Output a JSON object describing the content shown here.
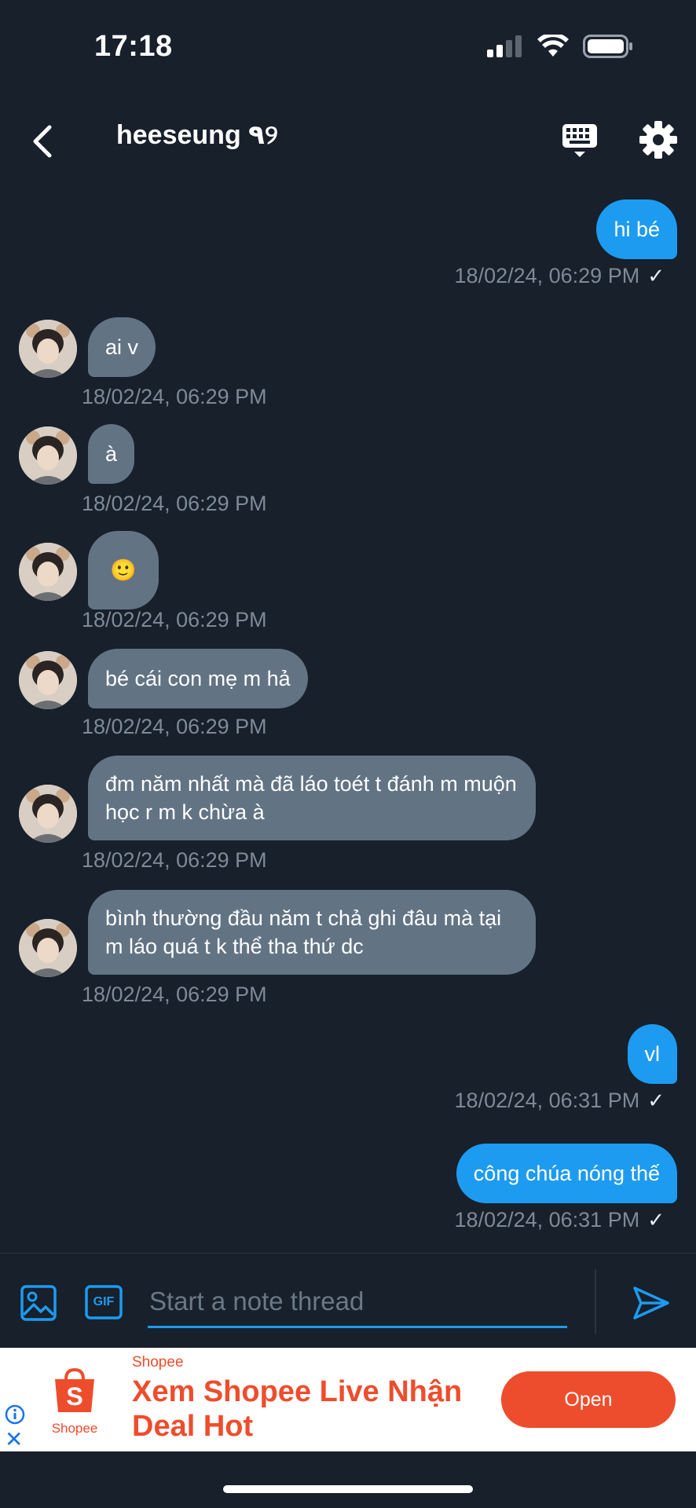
{
  "status_bar": {
    "time": "17:18"
  },
  "header": {
    "title": "heeseung ٩୨"
  },
  "messages": [
    {
      "direction": "out",
      "text": "hi bé",
      "timestamp": "18/02/24, 06:29 PM",
      "read": true
    },
    {
      "direction": "in",
      "text": "ai v",
      "timestamp": "18/02/24, 06:29 PM"
    },
    {
      "direction": "in",
      "text": "à",
      "timestamp": "18/02/24, 06:29 PM"
    },
    {
      "direction": "in",
      "text": "🙂",
      "timestamp": "18/02/24, 06:29 PM"
    },
    {
      "direction": "in",
      "text": "bé cái con mẹ m hả",
      "timestamp": "18/02/24, 06:29 PM"
    },
    {
      "direction": "in",
      "text": "đm năm nhất mà đã láo toét t đánh m muộn học r m k chừa à",
      "timestamp": "18/02/24, 06:29 PM"
    },
    {
      "direction": "in",
      "text": "bình thường đầu năm t chả ghi đâu mà tại m láo quá t k thể tha thứ dc",
      "timestamp": "18/02/24, 06:29 PM"
    },
    {
      "direction": "out",
      "text": "vl",
      "timestamp": "18/02/24, 06:31 PM",
      "read": true
    },
    {
      "direction": "out",
      "text": "công chúa nóng thế",
      "timestamp": "18/02/24, 06:31 PM",
      "read": true
    }
  ],
  "compose": {
    "placeholder": "Start a note thread",
    "gif_label": "GIF"
  },
  "ad": {
    "brand": "Shopee",
    "logo_text": "Shopee",
    "headline": "Xem Shopee Live Nhận Deal Hot",
    "button": "Open"
  },
  "colors": {
    "background": "#17202b",
    "outgoing_bubble": "#1d9bf0",
    "incoming_bubble": "#627384",
    "timestamp": "#7e8a97",
    "ad_accent": "#ee4d2d"
  }
}
